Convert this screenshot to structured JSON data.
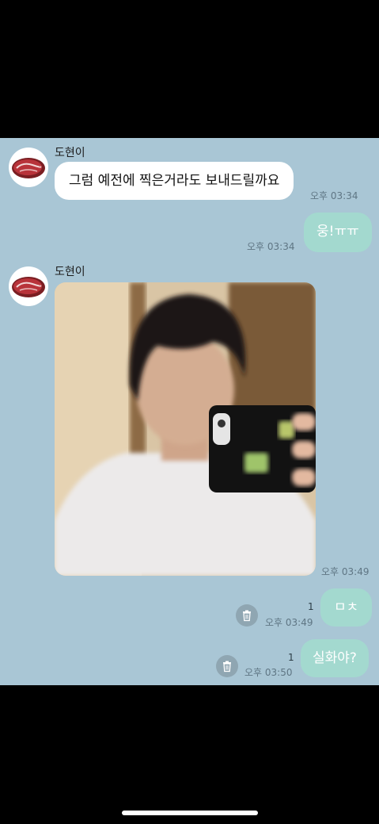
{
  "messages": {
    "m1": {
      "sender": "도현이",
      "text": "그럼 예전에 찍은거라도 보내드릴까요",
      "time": "오후 03:34"
    },
    "m2": {
      "text": "웅!ㅠㅠ",
      "time": "오후 03:34"
    },
    "m3": {
      "sender": "도현이",
      "time": "오후 03:49"
    },
    "m4": {
      "text": "ㅁㅊ",
      "time": "오후 03:49",
      "unread": "1"
    },
    "m5": {
      "text": "실화야?",
      "time": "오후 03:50",
      "unread": "1"
    }
  },
  "icons": {
    "avatar": "steak-icon",
    "delete": "trash-icon"
  },
  "colors": {
    "chat_background": "#a9c6d5",
    "incoming_bubble": "#ffffff",
    "outgoing_bubble": "#a3d9cf"
  }
}
